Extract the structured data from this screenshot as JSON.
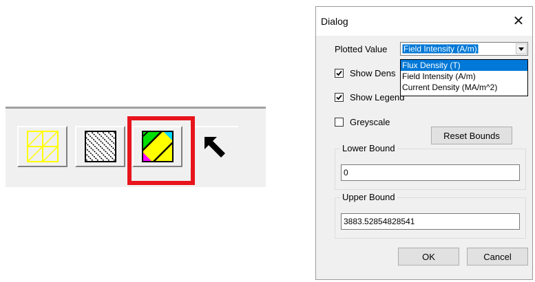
{
  "toolbar": {
    "buttons": [
      {
        "name": "yellow-grid-icon"
      },
      {
        "name": "hatched-pattern-icon"
      },
      {
        "name": "color-gradient-icon",
        "highlighted": true
      },
      {
        "name": "arrow-cursor-icon"
      }
    ],
    "highlight_color": "#e8141c"
  },
  "dialog": {
    "title": "Dialog",
    "close_glyph": "✕",
    "plotted_value": {
      "label": "Plotted Value",
      "selected": "Field Intensity (A/m)",
      "options": [
        "Flux Density (T)",
        "Field Intensity (A/m)",
        "Current Density (MA/m^2)"
      ],
      "highlighted_option": "Flux Density (T)"
    },
    "checkboxes": {
      "show_density": {
        "label": "Show Dens",
        "checked": true
      },
      "show_legend": {
        "label": "Show Legend",
        "checked": true
      },
      "greyscale": {
        "label": "Greyscale",
        "checked": false
      }
    },
    "reset_bounds_label": "Reset Bounds",
    "lower_bound": {
      "label": "Lower Bound",
      "value": "0"
    },
    "upper_bound": {
      "label": "Upper Bound",
      "value": "3883.52854828541"
    },
    "ok_label": "OK",
    "cancel_label": "Cancel"
  },
  "colors": {
    "selection": "#0078d7",
    "dialog_bg": "#f0f0f0"
  }
}
